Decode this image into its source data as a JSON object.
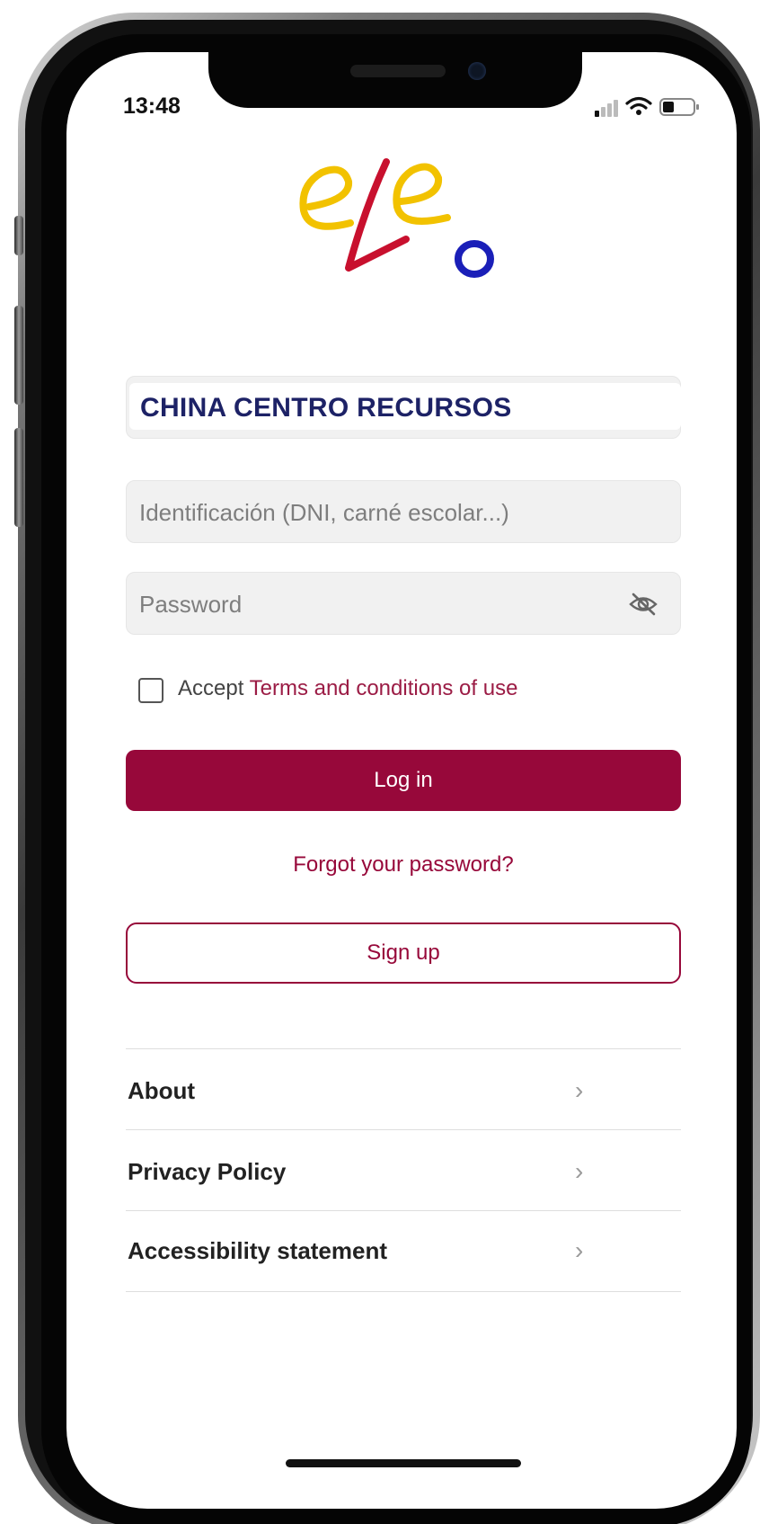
{
  "status_bar": {
    "time": "13:48",
    "icons": [
      "cellular-signal-icon",
      "wifi-icon",
      "battery-icon"
    ]
  },
  "logo": {
    "text": "eleo",
    "colors": {
      "e": "#f2c200",
      "l": "#c8102e",
      "o": "#1a1fb8"
    }
  },
  "center": {
    "name": "CHINA CENTRO RECURSOS"
  },
  "login_form": {
    "id_placeholder": "Identificación (DNI, carné escolar...)",
    "password_placeholder": "Password",
    "accept_label": "Accept ",
    "terms_link": "Terms and conditions of use",
    "login_button": "Log in",
    "forgot_link": "Forgot your password?",
    "signup_button": "Sign up"
  },
  "menu": {
    "items": [
      {
        "label": "About"
      },
      {
        "label": "Privacy Policy"
      },
      {
        "label": "Accessibility statement"
      }
    ]
  },
  "colors": {
    "accent": "#97083a",
    "center_name": "#1d2266"
  }
}
